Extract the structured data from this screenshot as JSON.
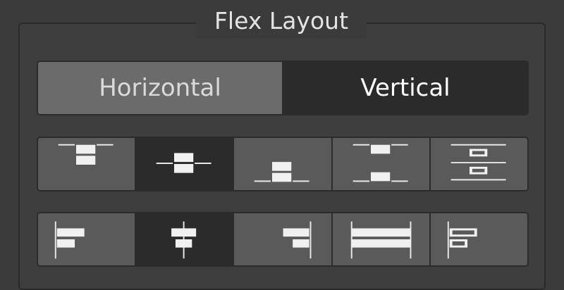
{
  "panel": {
    "title": "Flex Layout"
  },
  "direction_toggle": {
    "options": [
      {
        "label": "Horizontal",
        "selected": false
      },
      {
        "label": "Vertical",
        "selected": true
      }
    ]
  },
  "justify_row": {
    "selected_index": 1,
    "options": [
      {
        "icon": "justify-start-icon"
      },
      {
        "icon": "justify-center-icon"
      },
      {
        "icon": "justify-end-icon"
      },
      {
        "icon": "justify-space-between-icon"
      },
      {
        "icon": "justify-space-around-icon"
      }
    ]
  },
  "align_row": {
    "selected_index": 1,
    "options": [
      {
        "icon": "align-start-icon"
      },
      {
        "icon": "align-center-icon"
      },
      {
        "icon": "align-end-icon"
      },
      {
        "icon": "align-stretch-icon"
      },
      {
        "icon": "align-baseline-icon"
      }
    ]
  },
  "colors": {
    "background": "#3b3b3b",
    "inactive_button": "#6b6b6b",
    "selected_button": "#2b2b2b",
    "option_button": "#5a5a5a"
  }
}
